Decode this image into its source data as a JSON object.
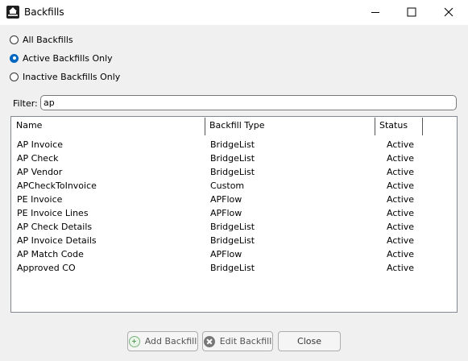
{
  "window": {
    "title": "Backfills",
    "icon": "app-house-icon",
    "controls": [
      "minimize-icon",
      "maximize-icon",
      "close-icon"
    ]
  },
  "options": [
    {
      "label": "All Backfills",
      "selected": false
    },
    {
      "label": "Active Backfills Only",
      "selected": true
    },
    {
      "label": "Inactive Backfills Only",
      "selected": false
    }
  ],
  "filter": {
    "label": "Filter:",
    "value": "ap"
  },
  "table": {
    "columns": [
      "Name",
      "Backfill Type",
      "Status"
    ],
    "rows": [
      {
        "name": "AP Invoice",
        "type": "BridgeList",
        "status": "Active"
      },
      {
        "name": "AP Check",
        "type": "BridgeList",
        "status": "Active"
      },
      {
        "name": "AP Vendor",
        "type": "BridgeList",
        "status": "Active"
      },
      {
        "name": "APCheckToInvoice",
        "type": "Custom",
        "status": "Active"
      },
      {
        "name": "PE Invoice",
        "type": "APFlow",
        "status": "Active"
      },
      {
        "name": "PE Invoice Lines",
        "type": "APFlow",
        "status": "Active"
      },
      {
        "name": "AP Check Details",
        "type": "BridgeList",
        "status": "Active"
      },
      {
        "name": "AP Invoice Details",
        "type": "BridgeList",
        "status": "Active"
      },
      {
        "name": "AP Match Code",
        "type": "APFlow",
        "status": "Active"
      },
      {
        "name": "Approved CO",
        "type": "BridgeList",
        "status": "Active"
      }
    ]
  },
  "buttons": {
    "add": "Add Backfill",
    "edit": "Edit Backfill",
    "close": "Close"
  },
  "colors": {
    "accent": "#0067c0",
    "add_icon": "#5e9a5e"
  }
}
